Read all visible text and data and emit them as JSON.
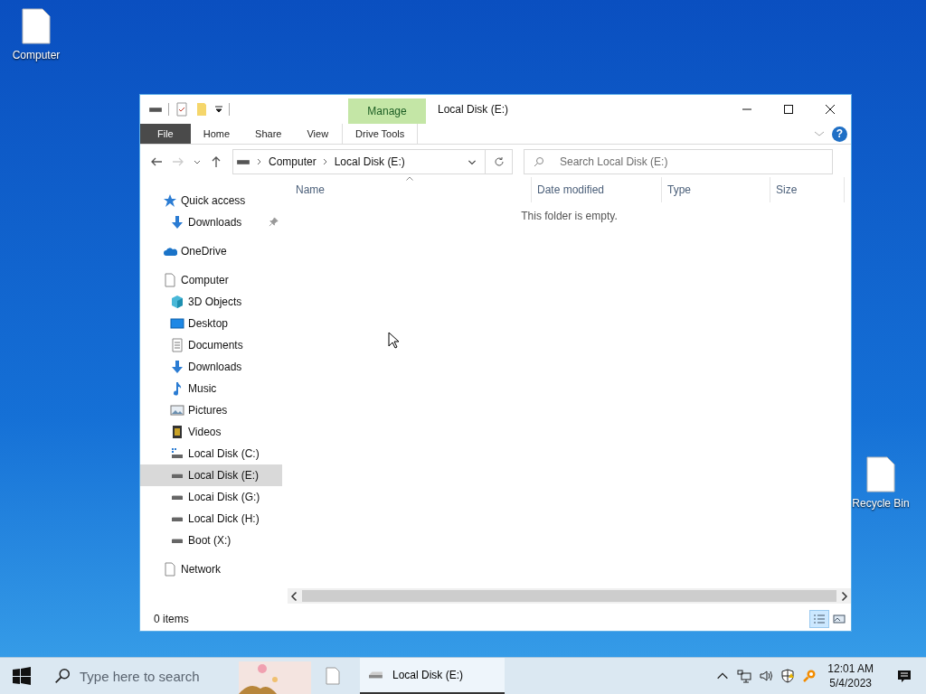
{
  "desktop_icons": [
    {
      "label": "Computer",
      "kind": "page"
    },
    {
      "label": "Recycle Bin",
      "kind": "page"
    }
  ],
  "window": {
    "title": "Local Disk (E:)",
    "context_group": "Manage",
    "help_label": "?"
  },
  "ribbon_tabs": [
    {
      "label": "File",
      "kind": "file"
    },
    {
      "label": "Home",
      "kind": "tab"
    },
    {
      "label": "Share",
      "kind": "tab"
    },
    {
      "label": "View",
      "kind": "tab"
    },
    {
      "label": "Drive Tools",
      "kind": "context"
    }
  ],
  "address": {
    "crumbs": [
      "Computer",
      "Local Disk (E:)"
    ]
  },
  "search": {
    "placeholder": "Search Local Disk (E:)"
  },
  "nav": [
    {
      "label": "Quick access",
      "kind": "star",
      "selected": false,
      "children": [
        {
          "label": "Downloads",
          "kind": "download",
          "selected": false,
          "pinned": true
        }
      ]
    },
    {
      "label": "OneDrive",
      "kind": "cloud",
      "selected": false
    },
    {
      "label": "Computer",
      "kind": "page",
      "selected": false,
      "children": [
        {
          "label": "3D Objects",
          "kind": "cube",
          "selected": false
        },
        {
          "label": "Desktop",
          "kind": "desktop",
          "selected": false
        },
        {
          "label": "Documents",
          "kind": "document",
          "selected": false
        },
        {
          "label": "Downloads",
          "kind": "download",
          "selected": false
        },
        {
          "label": "Music",
          "kind": "music",
          "selected": false
        },
        {
          "label": "Pictures",
          "kind": "pictures",
          "selected": false
        },
        {
          "label": "Videos",
          "kind": "videos",
          "selected": false
        },
        {
          "label": "Local Disk (C:)",
          "kind": "system",
          "selected": false
        },
        {
          "label": "Local Disk (E:)",
          "kind": "drive",
          "selected": true
        },
        {
          "label": "Locai Disk (G:)",
          "kind": "drive",
          "selected": false
        },
        {
          "label": "Local Dick (H:)",
          "kind": "drive",
          "selected": false
        },
        {
          "label": "Boot (X:)",
          "kind": "drive",
          "selected": false
        }
      ]
    },
    {
      "label": "Network",
      "kind": "page",
      "selected": false
    }
  ],
  "columns": [
    "Name",
    "Date modified",
    "Type",
    "Size"
  ],
  "empty_message": "This folder is empty.",
  "status": "0 items",
  "view_buttons": [
    {
      "kind": "details",
      "selected": true
    },
    {
      "kind": "tiles",
      "selected": false
    }
  ],
  "taskbar": {
    "search_placeholder": "Type here to search",
    "tasks": [
      {
        "label": "Local Disk (E:)",
        "selected": true
      }
    ],
    "time": "12:01 AM",
    "date": "5/4/2023"
  }
}
